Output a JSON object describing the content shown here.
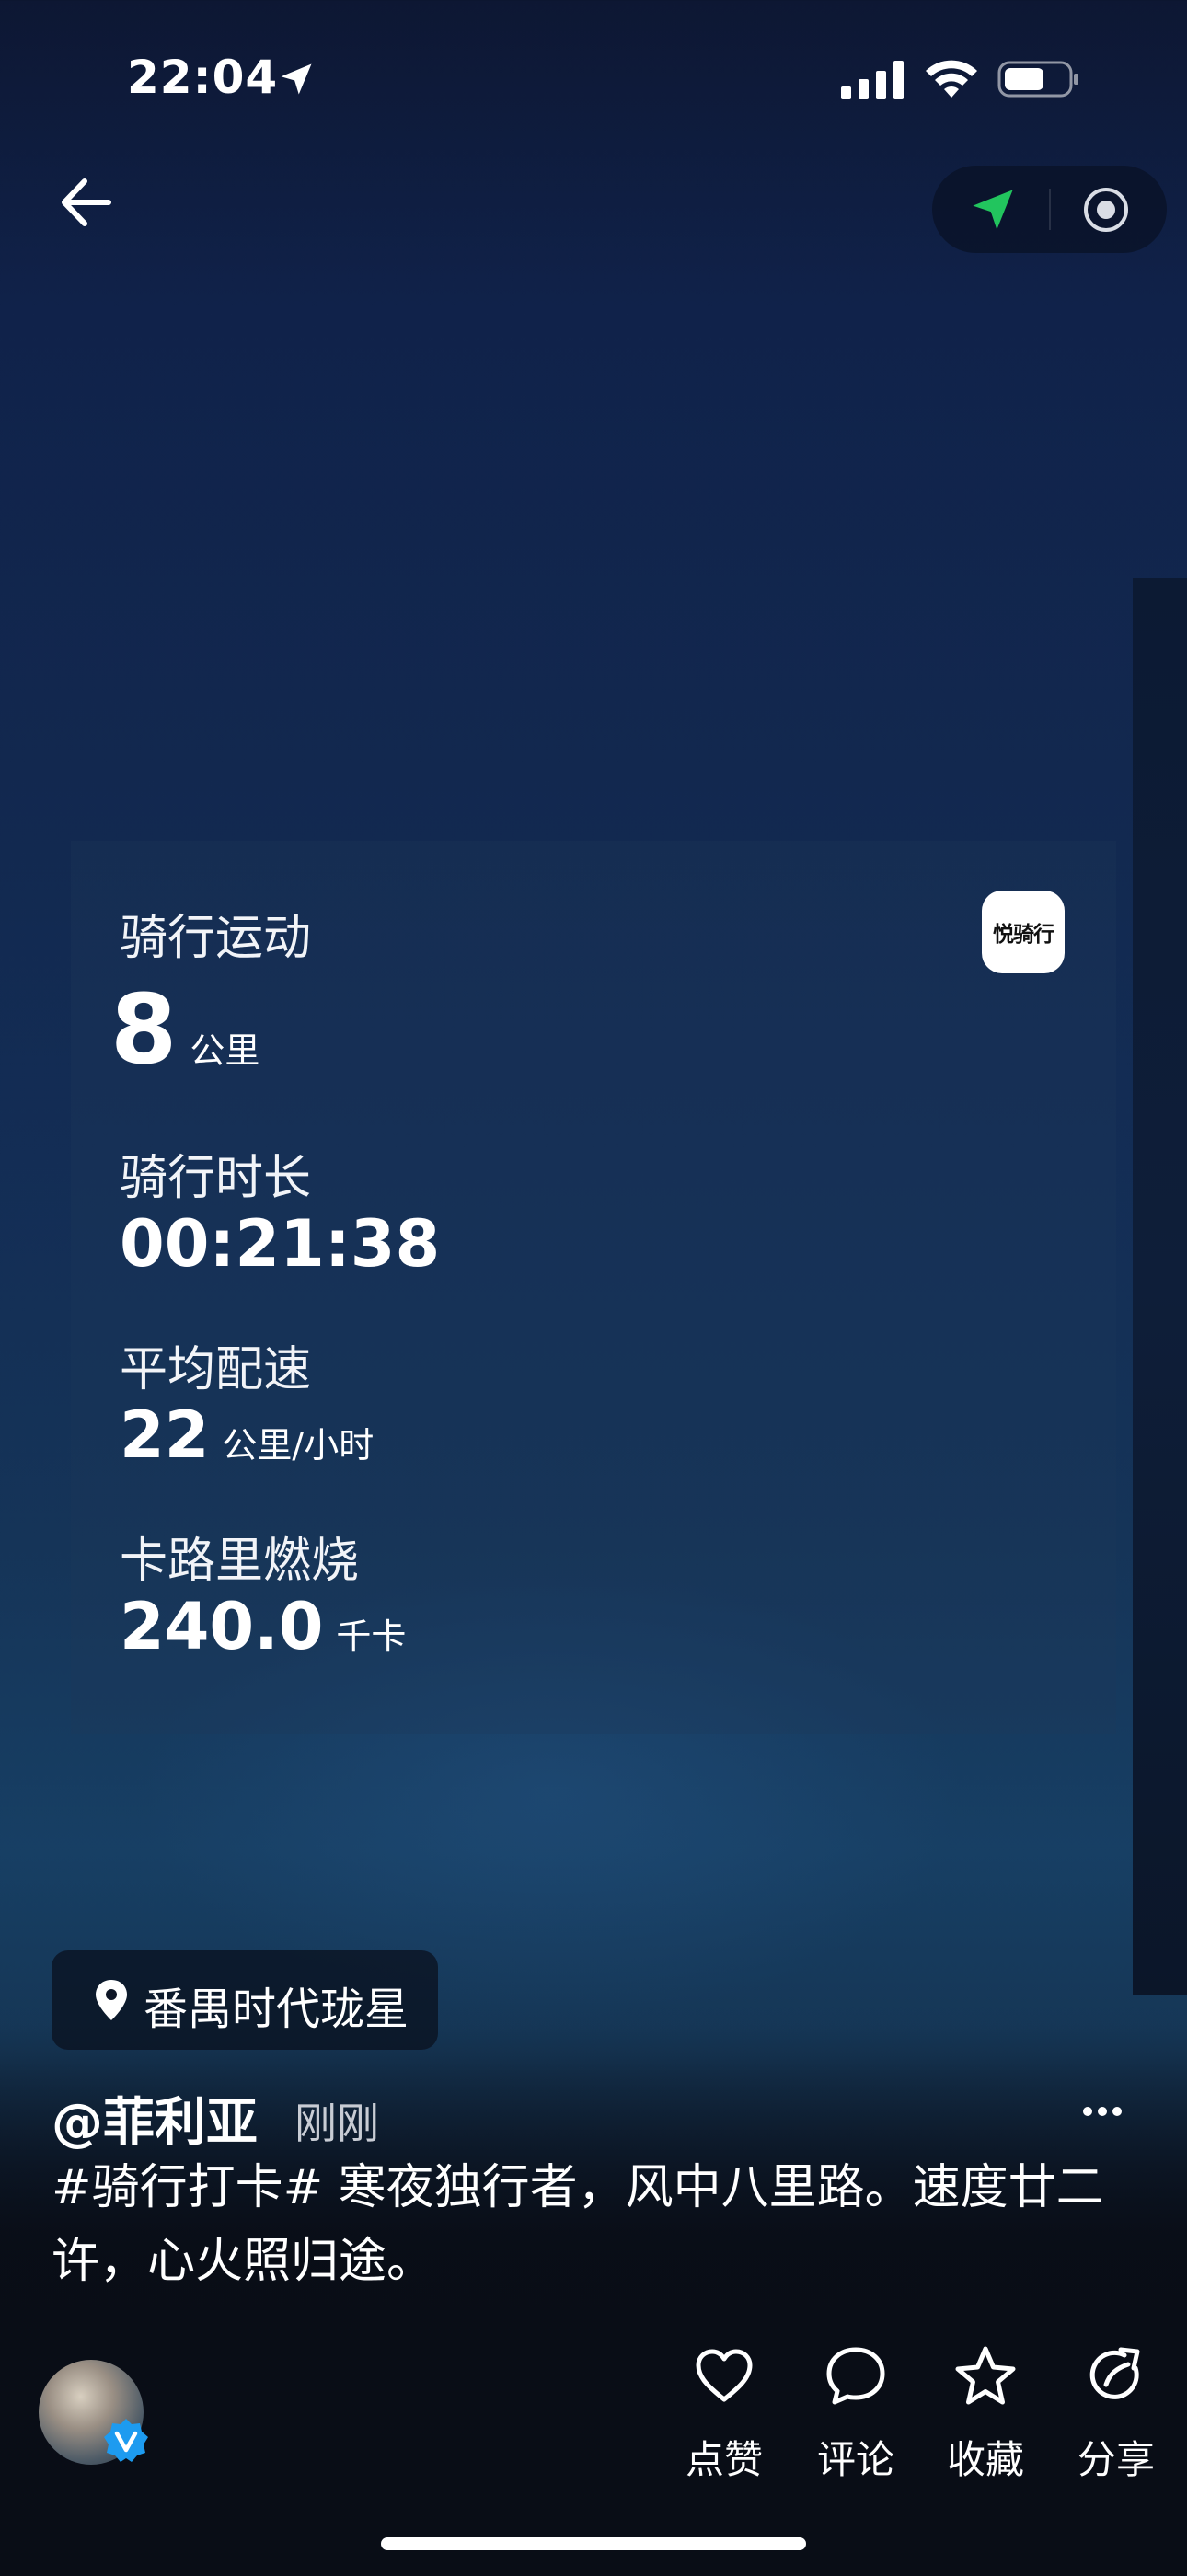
{
  "status_bar": {
    "time": "22:04"
  },
  "stats_card": {
    "app_logo_text": "悦骑行",
    "sport_type": "骑行运动",
    "distance_value": "8",
    "distance_unit": "公里",
    "duration_label": "骑行时长",
    "duration_value": "00:21:38",
    "pace_label": "平均配速",
    "pace_value": "22",
    "pace_unit": "公里/小时",
    "calories_label": "卡路里燃烧",
    "calories_value": "240.0",
    "calories_unit": "千卡"
  },
  "location": {
    "name": "番禺时代珑星"
  },
  "post": {
    "username": "@菲利亚",
    "time": "刚刚",
    "caption": "#骑行打卡# 寒夜独行者，风中八里路。速度廿二许，心火照归途。"
  },
  "actions": {
    "like": "点赞",
    "comment": "评论",
    "favorite": "收藏",
    "share": "分享"
  },
  "colors": {
    "accent_green": "#22c55e",
    "verified_blue": "#1d9bf0"
  },
  "icons": [
    "location-arrow-icon",
    "signal-icon",
    "wifi-icon",
    "battery-icon",
    "back-arrow-icon",
    "navigation-icon",
    "record-icon",
    "map-pin-icon",
    "more-icon",
    "heart-icon",
    "comment-icon",
    "star-icon",
    "share-icon",
    "verified-icon"
  ]
}
